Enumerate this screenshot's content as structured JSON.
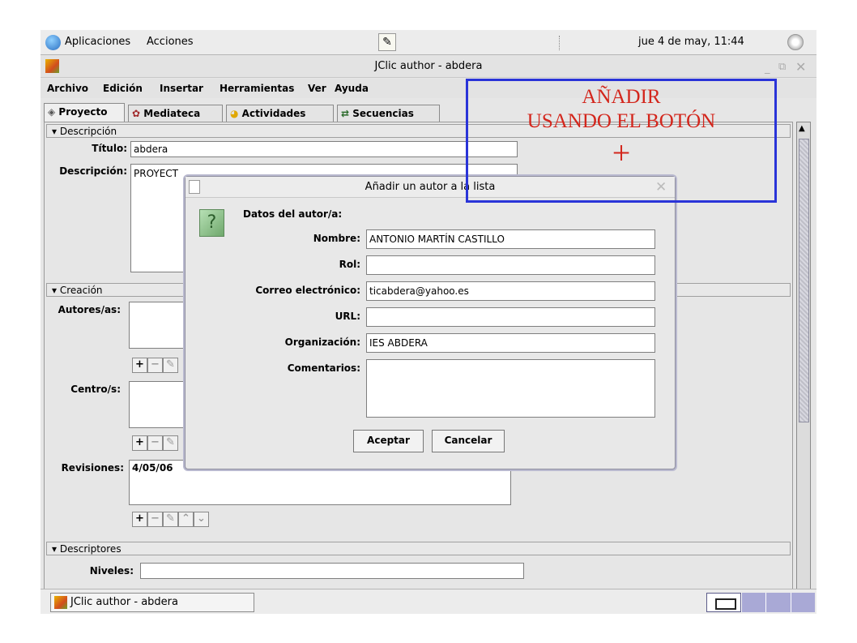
{
  "panel": {
    "apps": "Aplicaciones",
    "actions": "Acciones",
    "clock": "jue  4 de may, 11:44"
  },
  "window": {
    "title": "JClic author - abdera"
  },
  "menu": [
    "Archivo",
    "Edición",
    "Insertar",
    "Herramientas",
    "Ver",
    "Ayuda"
  ],
  "tabs": [
    "Proyecto",
    "Mediateca",
    "Actividades",
    "Secuencias"
  ],
  "descripcion": {
    "header": "Descripción",
    "titulo_label": "Título:",
    "titulo_value": "abdera",
    "desc_label": "Descripción:",
    "desc_value": "PROYECT"
  },
  "creacion": {
    "header": "Creación",
    "autores_label": "Autores/as:",
    "centro_label": "Centro/s:",
    "revisiones_label": "Revisiones:",
    "revision_value": "4/05/06"
  },
  "descriptores": {
    "header": "Descriptores",
    "niveles_label": "Niveles:"
  },
  "dialog": {
    "title": "Añadir un autor a la lista",
    "heading": "Datos del autor/a:",
    "fields": [
      {
        "label": "Nombre:",
        "value": "ANTONIO MARTÍN CASTILLO"
      },
      {
        "label": "Rol:",
        "value": ""
      },
      {
        "label": "Correo electrónico:",
        "value": "ticabdera@yahoo.es"
      },
      {
        "label": "URL:",
        "value": ""
      },
      {
        "label": "Organización:",
        "value": "IES ABDERA"
      }
    ],
    "comments_label": "Comentarios:",
    "ok": "Aceptar",
    "cancel": "Cancelar"
  },
  "annotation": {
    "line1": "AÑADIR",
    "line2": "USANDO EL BOTÓN",
    "symbol": "+"
  },
  "taskbar": {
    "task": "JClic author - abdera"
  },
  "colors": {
    "annotation_border": "#2a34d8",
    "annotation_text": "#d3261c"
  }
}
